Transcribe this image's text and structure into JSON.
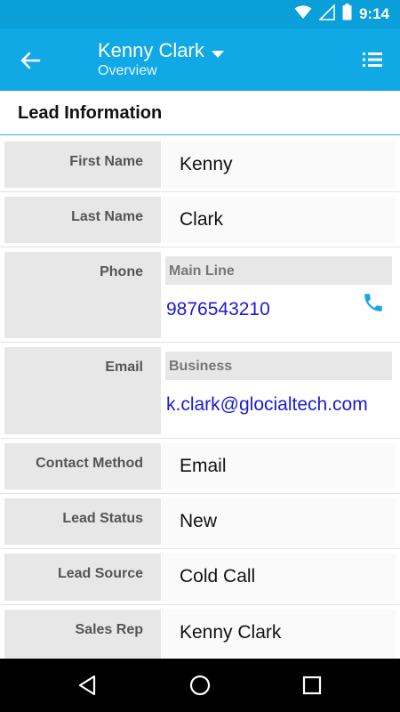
{
  "status_bar": {
    "time": "9:14",
    "icons": [
      "wifi-icon",
      "signal-icon",
      "battery-icon"
    ],
    "color": "#0a9fd8"
  },
  "app_bar": {
    "title": "Kenny Clark",
    "subtitle": "Overview",
    "color": "#11a8e6",
    "icons": [
      "arrow-back-icon",
      "chevron-down-icon",
      "list-menu-icon"
    ]
  },
  "section": {
    "title": "Lead Information"
  },
  "fields": [
    {
      "label": "First Name",
      "value": "Kenny"
    },
    {
      "label": "Last Name",
      "value": "Clark"
    },
    {
      "label": "Phone",
      "sub_label": "Main Line",
      "value": "9876543210",
      "icon": "phone-icon"
    },
    {
      "label": "Email",
      "sub_label": "Business",
      "value": "k.clark@glocialtech.com"
    },
    {
      "label": "Contact Method",
      "value": "Email"
    },
    {
      "label": "Lead Status",
      "value": "New"
    },
    {
      "label": "Lead Source",
      "value": "Cold Call"
    },
    {
      "label": "Sales Rep",
      "value": "Kenny Clark"
    }
  ],
  "nav_bar": {
    "icons": [
      "back-triangle-icon",
      "home-circle-icon",
      "recents-square-icon"
    ]
  },
  "colors": {
    "accent": "#11a8e6",
    "link": "#1a1ad6",
    "phone_icon": "#11a8e6"
  }
}
